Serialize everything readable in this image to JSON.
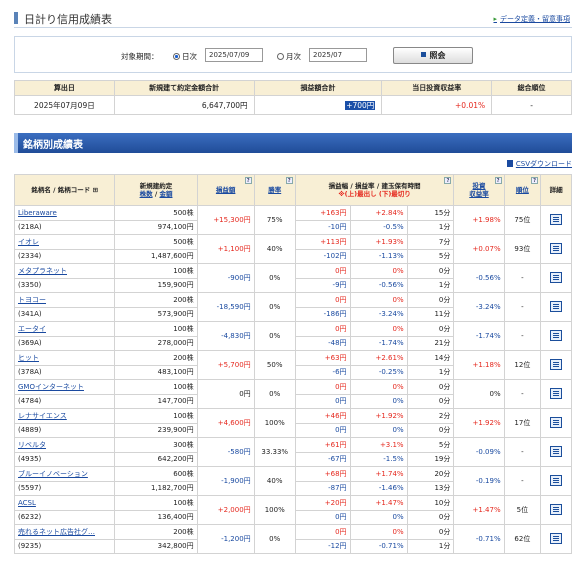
{
  "header": {
    "title": "日計り信用成績表",
    "link": "データ定義・留意事項"
  },
  "filter": {
    "label": "対象期間：",
    "daily": "日次",
    "monthly": "月次",
    "daily_value": "2025/07/09",
    "monthly_value": "2025/07",
    "button": "照会"
  },
  "summary": {
    "headers": [
      "算出日",
      "新規建て約定金額合計",
      "損益額合計",
      "当日投資収益率",
      "総合順位"
    ],
    "values": [
      "2025年07月09日",
      "6,647,700円",
      "+700円",
      "+0.01%",
      "-"
    ]
  },
  "section_title": "銘柄別成績表",
  "csv_link": "CSVダウンロード",
  "table": {
    "h_name": "銘柄名 / 銘柄コード",
    "h_amount_top": "新規建約定",
    "h_amount_shares": "株数",
    "h_amount_sep": " / ",
    "h_amount_total": "金額",
    "h_pl": "損益額",
    "h_win": "勝率",
    "h_range_top": "損益幅 / 損益率 / 建玉保有時間",
    "h_range_bottom": "※(上)最出し (下)最切り",
    "h_roi_top": "投資",
    "h_roi_bottom": "収益率",
    "h_rank": "順位",
    "h_detail": "詳細",
    "rows": [
      {
        "name": "Liberaware",
        "code": "(218A)",
        "shares": "500株",
        "amount": "974,100円",
        "pl": "+15,300円",
        "pl_c": "red",
        "win": "75%",
        "up_w": "+163円",
        "up_r": "+2.84%",
        "up_t": "15分",
        "dn_w": "-10円",
        "dn_r": "-0.5%",
        "dn_t": "1分",
        "roi": "+1.98%",
        "roi_c": "red",
        "rank": "75位"
      },
      {
        "name": "イオレ",
        "code": "(2334)",
        "shares": "500株",
        "amount": "1,487,600円",
        "pl": "+1,100円",
        "pl_c": "red",
        "win": "40%",
        "up_w": "+113円",
        "up_r": "+1.93%",
        "up_t": "7分",
        "dn_w": "-102円",
        "dn_r": "-1.13%",
        "dn_t": "5分",
        "roi": "+0.07%",
        "roi_c": "red",
        "rank": "93位"
      },
      {
        "name": "メタプラネット",
        "code": "(3350)",
        "shares": "100株",
        "amount": "159,900円",
        "pl": "-900円",
        "pl_c": "blu",
        "win": "0%",
        "up_w": "0円",
        "up_r": "0%",
        "up_t": "0分",
        "dn_w": "-9円",
        "dn_r": "-0.56%",
        "dn_t": "1分",
        "roi": "-0.56%",
        "roi_c": "blu",
        "rank": "-"
      },
      {
        "name": "トヨコー",
        "code": "(341A)",
        "shares": "200株",
        "amount": "573,900円",
        "pl": "-18,590円",
        "pl_c": "blu",
        "win": "0%",
        "up_w": "0円",
        "up_r": "0%",
        "up_t": "0分",
        "dn_w": "-186円",
        "dn_r": "-3.24%",
        "dn_t": "11分",
        "roi": "-3.24%",
        "roi_c": "blu",
        "rank": "-"
      },
      {
        "name": "エータイ",
        "code": "(369A)",
        "shares": "100株",
        "amount": "278,000円",
        "pl": "-4,830円",
        "pl_c": "blu",
        "win": "0%",
        "up_w": "0円",
        "up_r": "0%",
        "up_t": "0分",
        "dn_w": "-48円",
        "dn_r": "-1.74%",
        "dn_t": "21分",
        "roi": "-1.74%",
        "roi_c": "blu",
        "rank": "-"
      },
      {
        "name": "ヒット",
        "code": "(378A)",
        "shares": "200株",
        "amount": "483,100円",
        "pl": "+5,700円",
        "pl_c": "red",
        "win": "50%",
        "up_w": "+63円",
        "up_r": "+2.61%",
        "up_t": "14分",
        "dn_w": "-6円",
        "dn_r": "-0.25%",
        "dn_t": "1分",
        "roi": "+1.18%",
        "roi_c": "red",
        "rank": "12位"
      },
      {
        "name": "GMOインターネット",
        "code": "(4784)",
        "shares": "100株",
        "amount": "147,700円",
        "pl": "0円",
        "pl_c": "",
        "win": "0%",
        "up_w": "0円",
        "up_r": "0%",
        "up_t": "0分",
        "dn_w": "0円",
        "dn_r": "0%",
        "dn_t": "0分",
        "roi": "0%",
        "roi_c": "",
        "rank": "-"
      },
      {
        "name": "レナサイエンス",
        "code": "(4889)",
        "shares": "100株",
        "amount": "239,900円",
        "pl": "+4,600円",
        "pl_c": "red",
        "win": "100%",
        "up_w": "+46円",
        "up_r": "+1.92%",
        "up_t": "2分",
        "dn_w": "0円",
        "dn_r": "0%",
        "dn_t": "0分",
        "roi": "+1.92%",
        "roi_c": "red",
        "rank": "17位"
      },
      {
        "name": "リベルタ",
        "code": "(4935)",
        "shares": "300株",
        "amount": "642,200円",
        "pl": "-580円",
        "pl_c": "blu",
        "win": "33.33%",
        "up_w": "+61円",
        "up_r": "+3.1%",
        "up_t": "5分",
        "dn_w": "-67円",
        "dn_r": "-1.5%",
        "dn_t": "19分",
        "roi": "-0.09%",
        "roi_c": "blu",
        "rank": "-"
      },
      {
        "name": "ブルーイノベーション",
        "code": "(5597)",
        "shares": "600株",
        "amount": "1,182,700円",
        "pl": "-1,900円",
        "pl_c": "blu",
        "win": "40%",
        "up_w": "+68円",
        "up_r": "+1.74%",
        "up_t": "20分",
        "dn_w": "-87円",
        "dn_r": "-1.46%",
        "dn_t": "13分",
        "roi": "-0.19%",
        "roi_c": "blu",
        "rank": "-"
      },
      {
        "name": "ACSL",
        "code": "(6232)",
        "shares": "100株",
        "amount": "136,400円",
        "pl": "+2,000円",
        "pl_c": "red",
        "win": "100%",
        "up_w": "+20円",
        "up_r": "+1.47%",
        "up_t": "10分",
        "dn_w": "0円",
        "dn_r": "0%",
        "dn_t": "0分",
        "roi": "+1.47%",
        "roi_c": "red",
        "rank": "5位"
      },
      {
        "name": "売れるネット広告社グ…",
        "code": "(9235)",
        "shares": "200株",
        "amount": "342,800円",
        "pl": "-1,200円",
        "pl_c": "blu",
        "win": "0%",
        "up_w": "0円",
        "up_r": "0%",
        "up_t": "0分",
        "dn_w": "-12円",
        "dn_r": "-0.71%",
        "dn_t": "1分",
        "roi": "-0.71%",
        "roi_c": "blu",
        "rank": "62位"
      }
    ]
  }
}
